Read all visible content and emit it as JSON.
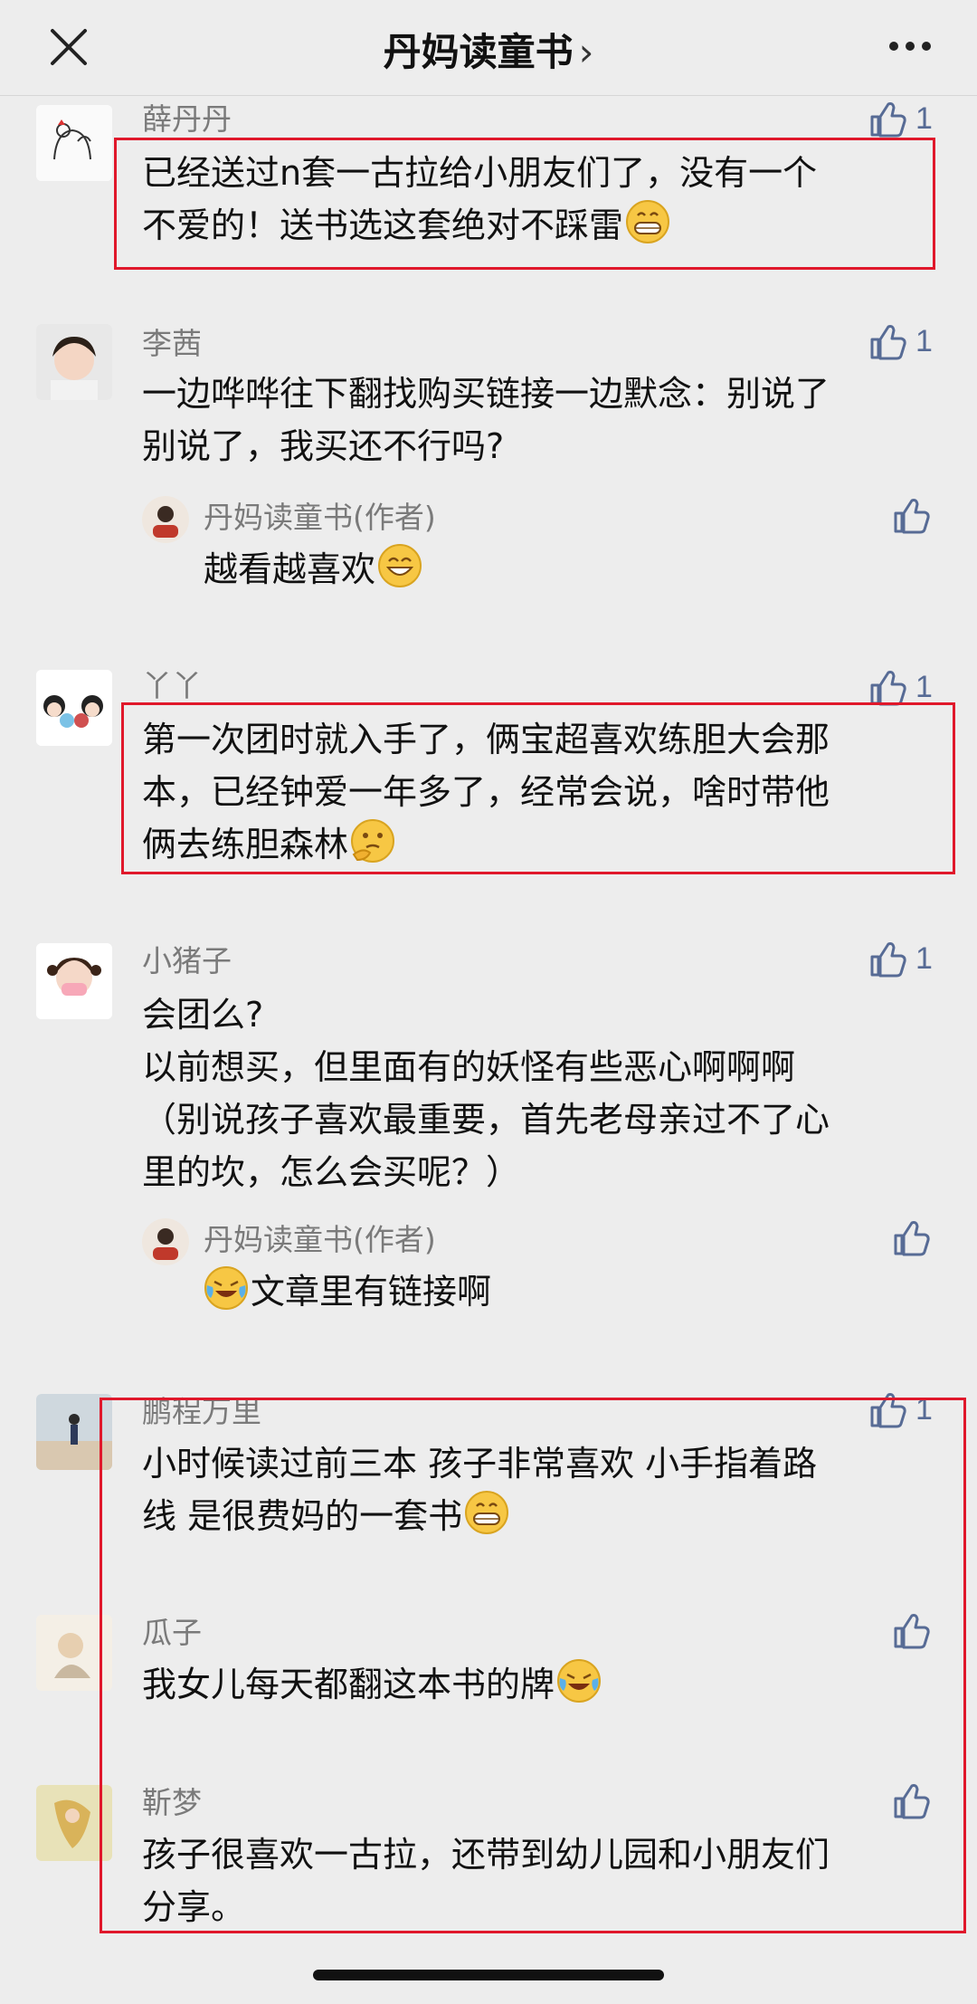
{
  "header": {
    "title": "丹妈读童书",
    "chevron": "›",
    "close_icon": "close-icon",
    "more_icon": "more-icon"
  },
  "comments": [
    {
      "name": "薛丹丹",
      "like_count": "1",
      "lines": [
        "已经送过n套一古拉给小朋友们了，没有一个",
        "不爱的！送书选这套绝对不踩雷"
      ],
      "emoji": "grin-emoji"
    },
    {
      "name": "李茜",
      "like_count": "1",
      "lines": [
        "一边哗哗往下翻找购买链接一边默念：别说了",
        "别说了，我买还不行吗?"
      ],
      "reply": {
        "name": "丹妈读童书(作者)",
        "text": "越看越喜欢",
        "emoji": "smile-emoji"
      }
    },
    {
      "name": "丫丫",
      "like_count": "1",
      "lines": [
        "第一次团时就入手了，俩宝超喜欢练胆大会那",
        "本，已经钟爱一年多了，经常会说，啥时带他",
        "俩去练胆森林"
      ],
      "emoji": "thinking-emoji"
    },
    {
      "name": "小猪子",
      "like_count": "1",
      "lines": [
        "会团么?",
        "以前想买，但里面有的妖怪有些恶心啊啊啊",
        "（别说孩子喜欢最重要，首先老母亲过不了心",
        "里的坎，怎么会买呢？）"
      ],
      "reply": {
        "name": "丹妈读童书(作者)",
        "text": "文章里有链接啊",
        "emoji": "cry-laugh-emoji"
      }
    },
    {
      "name": "鹏程万里",
      "like_count": "1",
      "lines": [
        "小时候读过前三本 孩子非常喜欢 小手指着路",
        "线 是很费妈的一套书"
      ],
      "emoji": "grin-emoji"
    },
    {
      "name": "瓜子",
      "like_count": "",
      "lines": [
        "我女儿每天都翻这本书的牌"
      ],
      "emoji": "cry-laugh-emoji"
    },
    {
      "name": "靳梦",
      "like_count": "",
      "lines": [
        "孩子很喜欢一古拉，还带到幼儿园和小朋友们",
        "分享。"
      ]
    }
  ],
  "colors": {
    "background": "#ededed",
    "highlight_box": "#e0182b",
    "like_blue": "#576b95",
    "name_gray": "#7a7a7a"
  }
}
